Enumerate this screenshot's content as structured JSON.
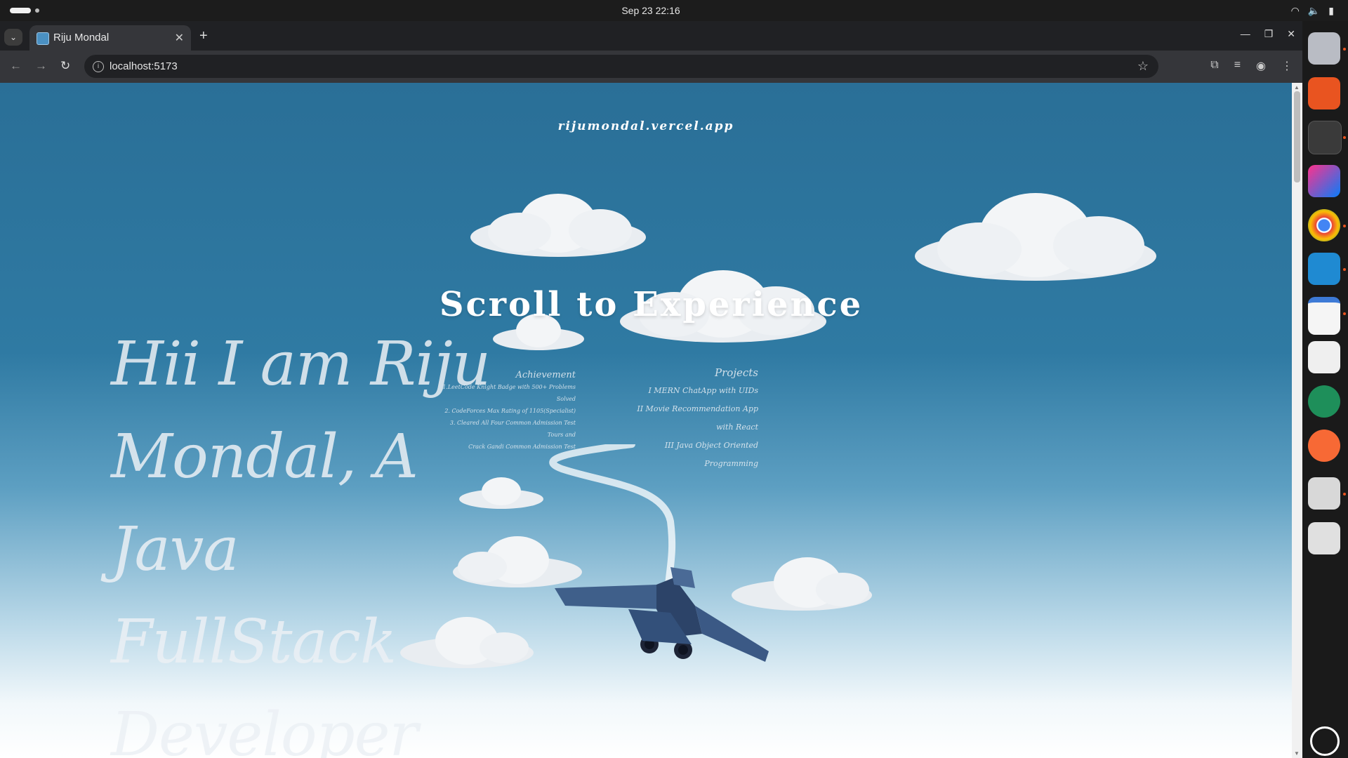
{
  "system": {
    "clock": "Sep 23  22:16"
  },
  "browser": {
    "tab": {
      "title": "Riju Mondal"
    },
    "address": {
      "url": "localhost:5173"
    }
  },
  "page": {
    "site_name": "rijumondal.vercel.app",
    "scroll_title": "Scroll to Experience",
    "hero_lines": [
      "Hii I am Riju",
      "Mondal, A Java",
      "FullStack Developer"
    ],
    "achievements": {
      "heading": "Achievement",
      "items": [
        "1.LeetCode Knight Badge with 500+ Problems Solved",
        "2. CodeForces Max Rating of 1105(Specialist)",
        "3. Cleared All Four Common Admission Test Tours and",
        "Crack Gandi Common Admission Test"
      ]
    },
    "projects": {
      "heading": "Projects",
      "items": [
        "I MERN ChatApp with UIDs",
        "II Movie Recommendation App with React",
        "III Java Object Oriented Programming"
      ]
    }
  },
  "dock": {
    "apps": [
      "files-icon",
      "app-center-icon",
      "terminal-icon",
      "intellij-icon",
      "chrome-icon",
      "vscode-icon",
      "text-editor-icon",
      "gimp-icon",
      "remote-desktop-icon",
      "postman-icon",
      "image-viewer-icon",
      "trash-icon",
      "ubuntu-menu-icon"
    ]
  },
  "colors": {
    "sky_top": "#2a6f97",
    "sky_bottom": "#ffffff",
    "accent": "#e95420"
  }
}
